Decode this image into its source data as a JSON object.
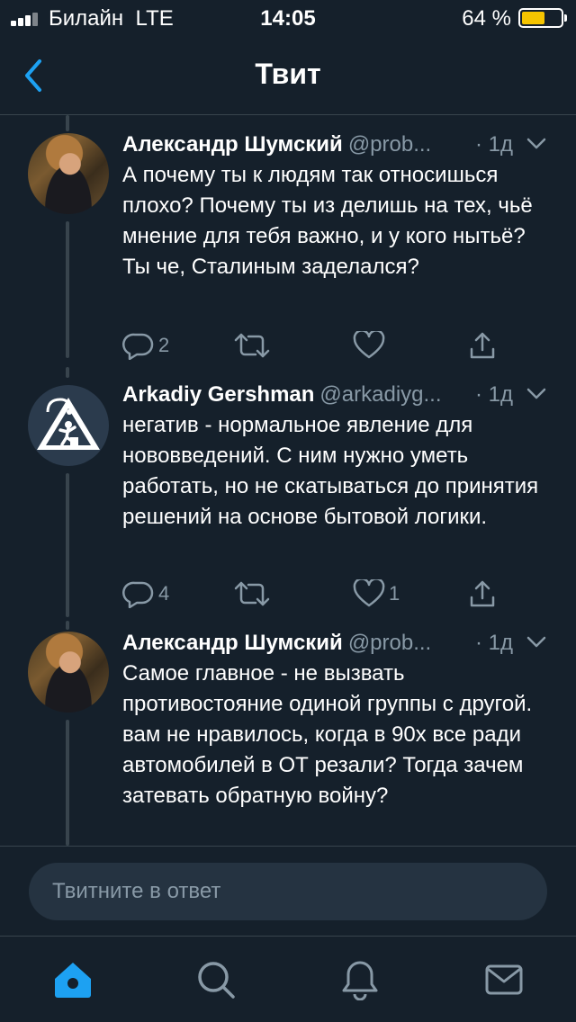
{
  "status_bar": {
    "carrier": "Билайн",
    "network": "LTE",
    "time": "14:05",
    "battery": "64 %",
    "battery_level": 0.64
  },
  "nav": {
    "title": "Твит"
  },
  "tweets": [
    {
      "name": "Александр Шумский",
      "handle": "@prob...",
      "time": "· 1д",
      "text": "А почему ты к людям так относишься плохо? Почему ты из делишь на тех, чьё мнение для тебя важно, и у кого нытьё? Ты че, Сталиным заделался?",
      "replies": "2",
      "likes": ""
    },
    {
      "name": "Arkadiy Gershman",
      "handle": "@arkadiyg...",
      "time": "· 1д",
      "text": "негатив - нормальное явление для нововведений. С ним нужно уметь работать, но не скатываться до принятия решений на основе бытовой логики.",
      "replies": "4",
      "likes": "1"
    },
    {
      "name": "Александр Шумский",
      "handle": "@prob...",
      "time": "· 1д",
      "text": "Самое главное - не вызвать противостояние одиной группы с другой. вам не нравилось, когда в 90х все ради автомобилей в ОТ резали? Тогда зачем затевать обратную войну?"
    }
  ],
  "reply": {
    "placeholder": "Твитните в ответ"
  },
  "colors": {
    "accent": "#1da1f2",
    "background": "#15202b",
    "muted": "#8899a6",
    "battery": "#f5c400"
  },
  "icons": {
    "tabs": [
      "home-icon",
      "search-icon",
      "notifications-icon",
      "messages-icon"
    ],
    "actions": [
      "reply-icon",
      "retweet-icon",
      "like-icon",
      "share-icon"
    ]
  }
}
